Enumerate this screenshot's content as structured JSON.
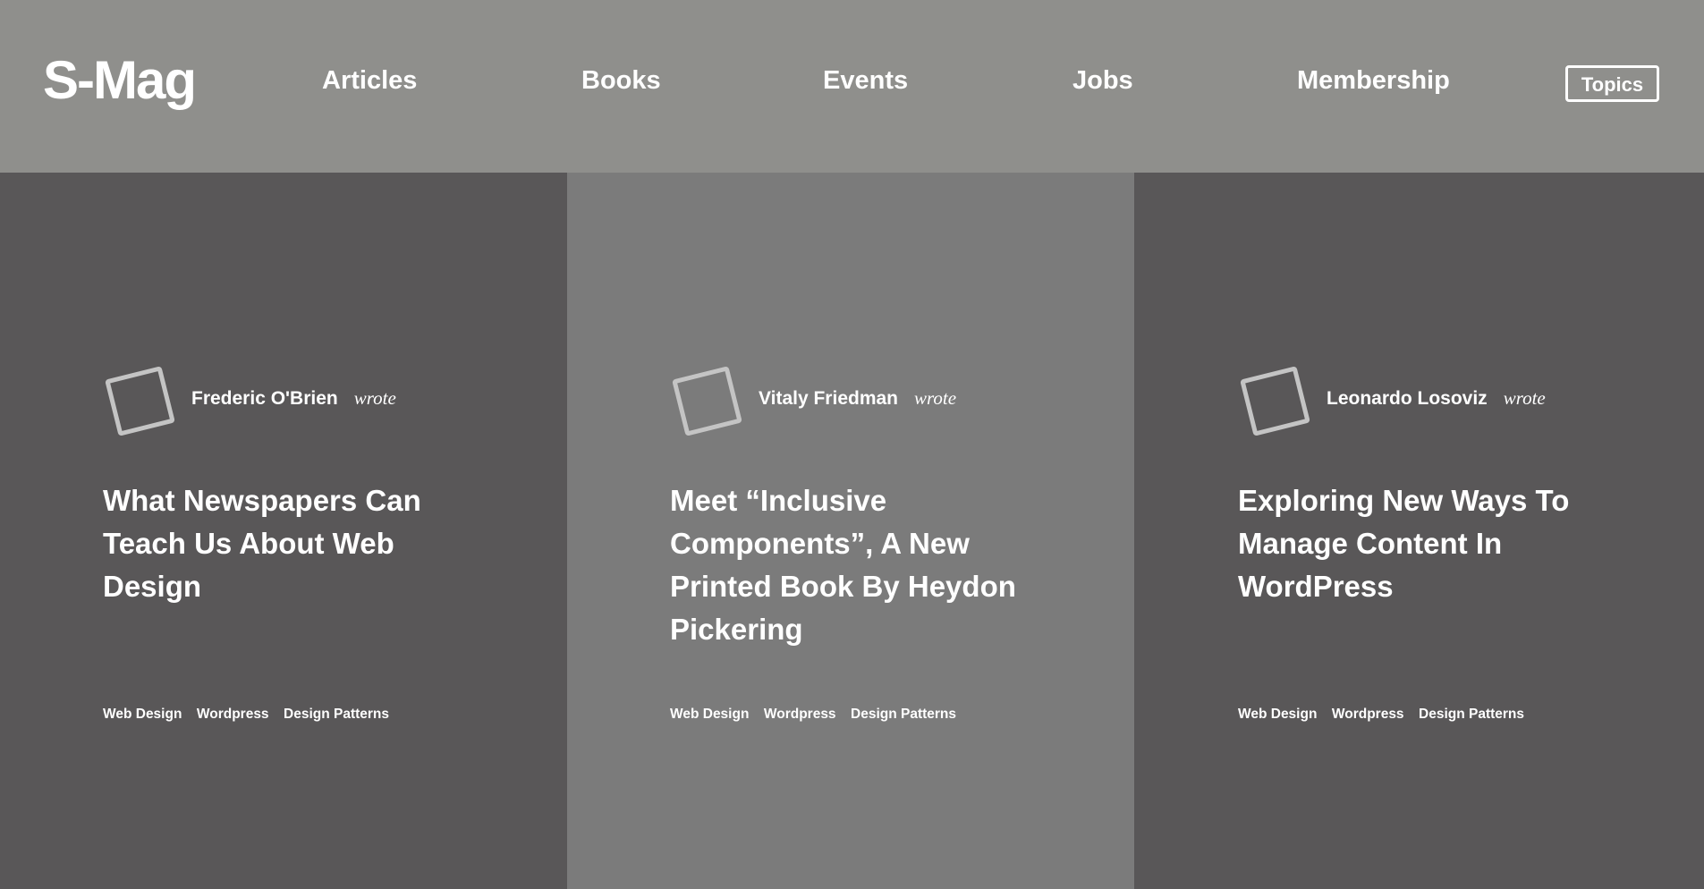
{
  "header": {
    "logo": "S-Mag",
    "nav": [
      {
        "label": "Articles"
      },
      {
        "label": "Books"
      },
      {
        "label": "Events"
      },
      {
        "label": "Jobs"
      },
      {
        "label": "Membership"
      }
    ],
    "topics_button": "Topics"
  },
  "colors": {
    "header_bg": "#8f8f8c",
    "card_dark": "#595758",
    "card_mid": "#7b7b7b",
    "avatar_border": "#c4c4c4",
    "text": "#ffffff"
  },
  "cards": [
    {
      "author": "Frederic O'Brien",
      "wrote": "wrote",
      "avatar_icon": "square-avatar-icon",
      "title": "What Newspapers Can Teach Us About Web Design",
      "tags": [
        "Web Design",
        "Wordpress",
        "Design Patterns"
      ]
    },
    {
      "author": "Vitaly Friedman",
      "wrote": "wrote",
      "avatar_icon": "square-avatar-icon",
      "title": "Meet “Inclusive Components”, A New Printed Book By Heydon Pickering",
      "tags": [
        "Web Design",
        "Wordpress",
        "Design Patterns"
      ]
    },
    {
      "author": "Leonardo Losoviz",
      "wrote": "wrote",
      "avatar_icon": "square-avatar-icon",
      "title": "Exploring New Ways To Manage Content In WordPress",
      "tags": [
        "Web Design",
        "Wordpress",
        "Design Patterns"
      ]
    }
  ]
}
